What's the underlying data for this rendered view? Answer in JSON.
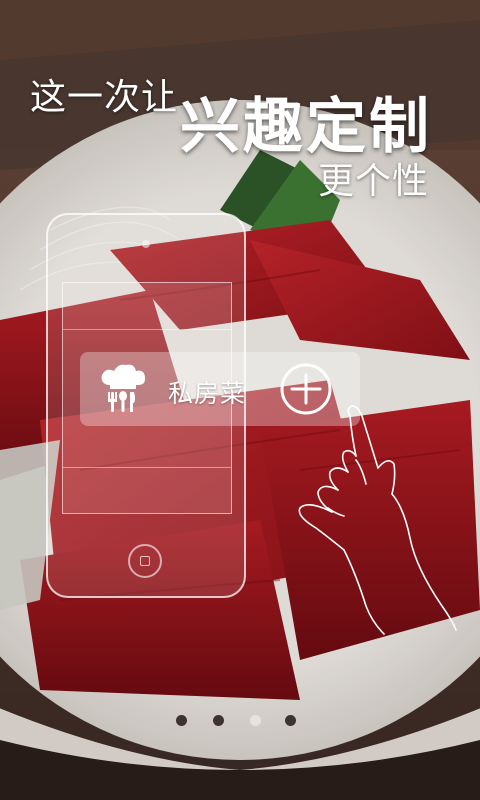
{
  "headline": {
    "line1_prefix": "这一次让",
    "line1_strong": "兴趣定制",
    "line2": "更个性"
  },
  "tag": {
    "label": "私房菜",
    "icon": "chef-hat-utensils-icon",
    "action_icon": "plus-circle-icon"
  },
  "pager": {
    "count": 4,
    "active_index": 2
  },
  "colors": {
    "text": "#ffffff",
    "fish": "#b01e24",
    "plate": "#ece7e2",
    "dot_inactive": "#231916",
    "dot_active": "#e6e3df"
  }
}
